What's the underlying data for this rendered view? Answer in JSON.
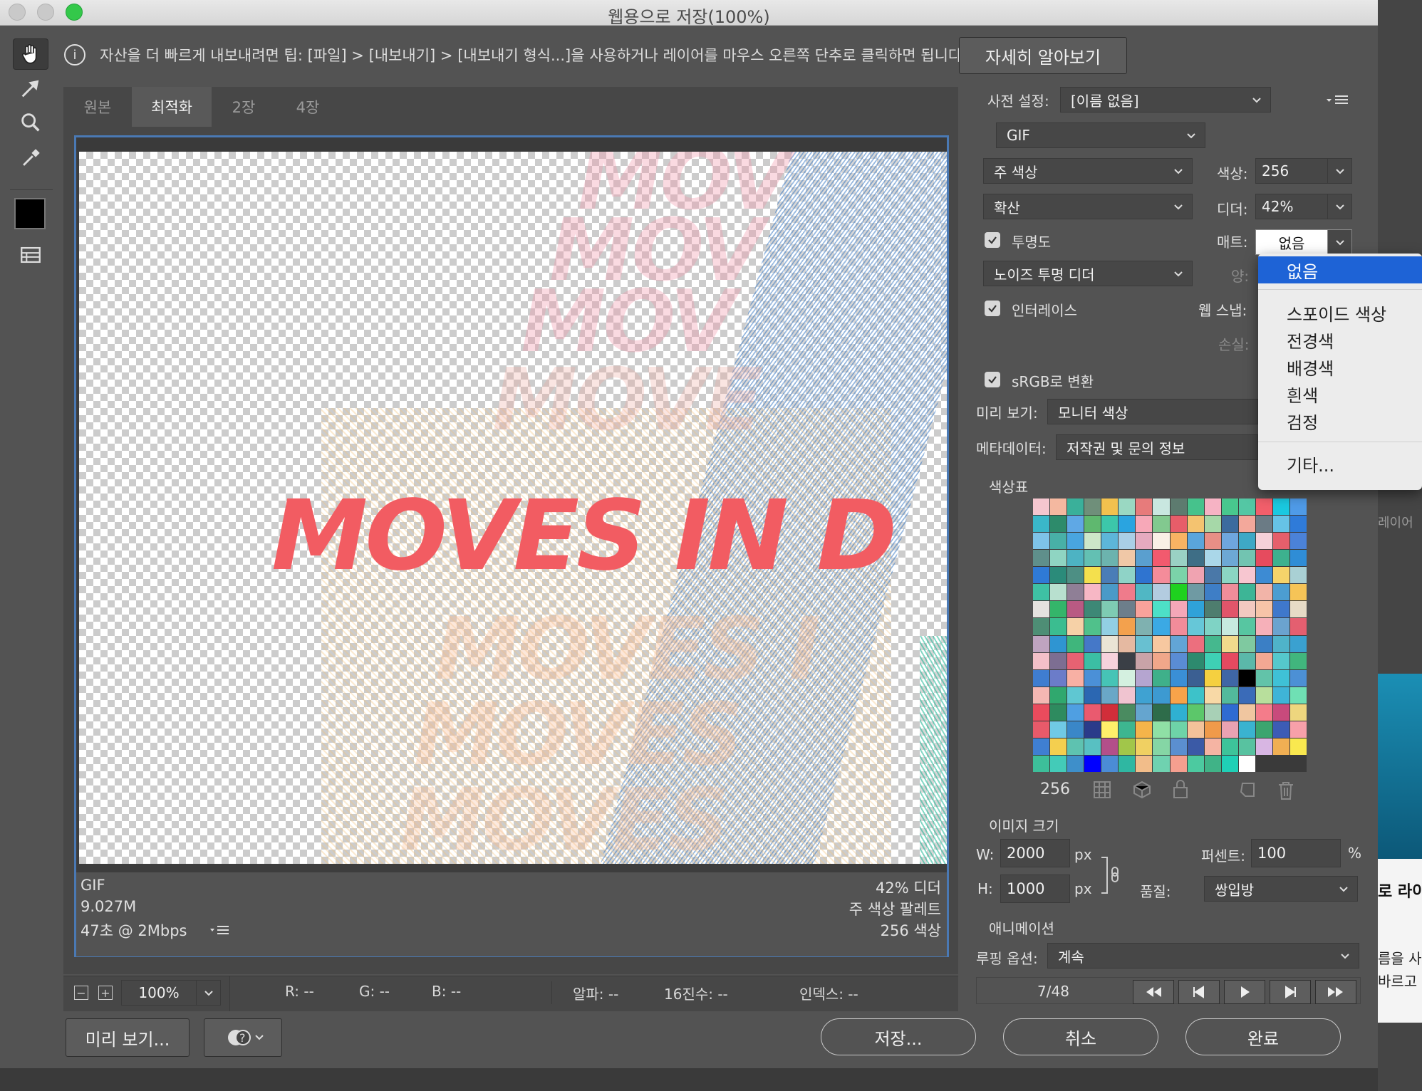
{
  "window": {
    "title": "웹용으로 저장(100%)"
  },
  "infobar": {
    "tip": "자산을 더 빠르게 내보내려면 팁: [파일] > [내보내기] > [내보내기 형식...]을 사용하거나 레이어를 마우스 오른쪽 단추로 클릭하면 됩니다.",
    "learn_more": "자세히 알아보기"
  },
  "tabs": [
    "원본",
    "최적화",
    "2장",
    "4장"
  ],
  "active_tab": "최적화",
  "preview": {
    "headline": "MOVES IN D",
    "ghost_text": [
      "MOV",
      "MOV",
      "MOV",
      "MOVE",
      "MOVES I",
      "MOVES",
      "MOVES"
    ],
    "info_left": [
      "GIF",
      "9.027M",
      "47초 @ 2Mbps"
    ],
    "info_right": [
      "42% 디더",
      "주 색상 팔레트",
      "256 색상"
    ]
  },
  "zoom": {
    "value": "100%"
  },
  "readout": {
    "r": "R: --",
    "g": "G: --",
    "b": "B: --",
    "alpha": "알파: --",
    "hex": "16진수: --",
    "index": "인덱스: --"
  },
  "settings": {
    "preset_label": "사전 설정:",
    "preset_value": "[이름 없음]",
    "format": "GIF",
    "reduction": "주 색상",
    "colors_label": "색상:",
    "colors_value": "256",
    "dither_algo": "확산",
    "dither_label": "디더:",
    "dither_value": "42%",
    "transparency_label": "투명도",
    "matte_label": "매트:",
    "matte_value": "없음",
    "transparency_dither": "노이즈 투명 디더",
    "amount_label": "양:",
    "interlace_label": "인터레이스",
    "websnap_label": "웹 스냅:",
    "lossy_label": "손실:",
    "srgb_label": "sRGB로 변환",
    "preview_label": "미리 보기:",
    "preview_value": "모니터 색상",
    "metadata_label": "메타데이터:",
    "metadata_value": "저작권 및 문의 정보",
    "color_table_label": "색상표",
    "color_count": "256",
    "image_size_label": "이미지 크기",
    "w_label": "W:",
    "w_value": "2000",
    "h_label": "H:",
    "h_value": "1000",
    "px": "px",
    "percent_label": "퍼센트:",
    "percent_value": "100",
    "percent_unit": "%",
    "quality_label": "품질:",
    "quality_value": "쌍입방",
    "animation_label": "애니메이션",
    "looping_label": "루핑 옵션:",
    "looping_value": "계속",
    "frame_counter": "7/48"
  },
  "matte_menu": {
    "items": [
      "없음",
      "스포이드 색상",
      "전경색",
      "배경색",
      "흰색",
      "검정",
      "기타..."
    ],
    "selected": "없음"
  },
  "buttons": {
    "preview": "미리 보기...",
    "save": "저장...",
    "cancel": "취소",
    "done": "완료"
  },
  "background_app": {
    "labels": [
      "레이어",
      "로 라이브",
      "름을 사",
      "바르고"
    ]
  },
  "palette_colors": [
    "#f5c6cf",
    "#f4b8a0",
    "#3ab09a",
    "#6f8f7a",
    "#f2c14e",
    "#9ad8c2",
    "#e77b7b",
    "#c9e7e0",
    "#5d7b6f",
    "#46c28c",
    "#f6b3c4",
    "#48c78e",
    "#54c7a4",
    "#f25f6b",
    "#1ac9e0",
    "#4f9be8",
    "#3ab7c9",
    "#2d8b6b",
    "#5fa8e5",
    "#5fb86f",
    "#3cc7aa",
    "#2aa4e0",
    "#f7a8b8",
    "#82c98f",
    "#e75d69",
    "#f4c370",
    "#a6d8a8",
    "#3c6b9e",
    "#f3a89b",
    "#6b7b85",
    "#66c3e6",
    "#2f7bd9",
    "#7ec3e8",
    "#48b0a7",
    "#49a5e0",
    "#cde7c9",
    "#5db6d9",
    "#aacfe6",
    "#e6aabf",
    "#f9f0e6",
    "#f8b363",
    "#5aa5db",
    "#e78f86",
    "#6fa6de",
    "#3ea8c6",
    "#f6d0d8",
    "#e55f6b",
    "#4b82d8",
    "#5f8f8b",
    "#8fd5c2",
    "#4db3c3",
    "#63c0b3",
    "#6cb3ae",
    "#f0c8a7",
    "#5a9fcf",
    "#f25a6e",
    "#9ad1c4",
    "#3e6e86",
    "#aad7e9",
    "#6da8d5",
    "#72c4b1",
    "#e64b5e",
    "#3db18e",
    "#2f8dd6",
    "#2f7ad6",
    "#2b8b7a",
    "#4d8f84",
    "#f4e04d",
    "#4a7db7",
    "#8fd3c7",
    "#2f74d0",
    "#f48c9a",
    "#7bd3a9",
    "#f0a3b1",
    "#4a78a8",
    "#8bd5c3",
    "#f7c6d0",
    "#3d8bd3",
    "#f5d36a",
    "#a9d0d4",
    "#3ec1a4",
    "#b8e0cf",
    "#8f7f96",
    "#f7b7c5",
    "#4a9ac8",
    "#ef7b8b",
    "#50b7c4",
    "#b3cce0",
    "#1fd11f",
    "#6f9aa3",
    "#3e7ec6",
    "#ef8d9a",
    "#3db596",
    "#f2b4a8",
    "#4c9dd1",
    "#f6c457",
    "#e5e2df",
    "#34b56a",
    "#b95a83",
    "#3d8876",
    "#7ecbb3",
    "#6d7e8b",
    "#f9a29b",
    "#4de0c7",
    "#f4a7b8",
    "#2fa2d9",
    "#4e7d6e",
    "#e1556a",
    "#f3c9c0",
    "#f7c4a8",
    "#3f78cb",
    "#e7dbc6",
    "#4e8e75",
    "#3bbd90",
    "#f6d1a7",
    "#50c18b",
    "#92cfe3",
    "#f3a14d",
    "#7fb1b0",
    "#3ba9e4",
    "#f28c9a",
    "#66c7d8",
    "#7fd3c5",
    "#c7eadf",
    "#57c6a1",
    "#f6b0b9",
    "#6ba3cf",
    "#e45f70",
    "#bfa4c0",
    "#2f95d2",
    "#3fb67c",
    "#4578c8",
    "#eae4d5",
    "#e5b9a1",
    "#68c0d1",
    "#f7c8a0",
    "#62a5d6",
    "#ec6f7e",
    "#45b88e",
    "#f2da8c",
    "#7fc9a0",
    "#3b7fc5",
    "#4fb3c9",
    "#3aa1d0",
    "#f3c0c9",
    "#7d6e92",
    "#e66272",
    "#3bbea4",
    "#f7d2dc",
    "#3a3f46",
    "#c9a3a8",
    "#f0a78a",
    "#5a8cd4",
    "#2d8a6e",
    "#3ed0b5",
    "#e54a60",
    "#5bb8a9",
    "#f3a893",
    "#55c8cc",
    "#41b67d",
    "#3f7dd0",
    "#6b7cc9",
    "#f8b0a4",
    "#4b90d7",
    "#46c4b6",
    "#d4f0e0",
    "#b5a5d0",
    "#3fb08a",
    "#3a8fd6",
    "#3b5f92",
    "#f5d040",
    "#3f66a6",
    "#000000",
    "#62c3a9",
    "#3fc1d6",
    "#4c90d5",
    "#f4b7b3",
    "#30a86e",
    "#5fc7d2",
    "#2b67b2",
    "#6aa7c7",
    "#f0c4d0",
    "#3fa2d2",
    "#3d9ad1",
    "#f7a34a",
    "#3dc2c9",
    "#f8d9a6",
    "#52ba9c",
    "#3a6bb8",
    "#b8df9c",
    "#3fb4d7",
    "#6fe0b4",
    "#ea4b5d",
    "#2e8b5f",
    "#4f9fe2",
    "#ea5a6f",
    "#d12e3a",
    "#4a8b60",
    "#65a5cf",
    "#2e6c4a",
    "#2fb0d2",
    "#5cc76a",
    "#a8d0b6",
    "#2f6bd2",
    "#f0c6a0",
    "#f47c8a",
    "#c84a7c",
    "#eed67e",
    "#e85a6a",
    "#70c9e5",
    "#3a87c8",
    "#2a3b8a",
    "#ffef6a",
    "#3db690",
    "#f5b44a",
    "#8fe0a5",
    "#6ed3a8",
    "#f3c29a",
    "#f09a4a",
    "#e9a2b2",
    "#3ab3d0",
    "#3ba56f",
    "#3c5cb5",
    "#f7a0a9",
    "#3f7fd2",
    "#f4cf4f",
    "#5ec2b0",
    "#58c0c2",
    "#b34f8a",
    "#a1c64a",
    "#f0d062",
    "#85d6a5",
    "#5b8fd0",
    "#3b5aa6",
    "#f5b4a3",
    "#3dc49a",
    "#58c2a0",
    "#d8b6e3",
    "#f0af53",
    "#f9e84f",
    "#3dbf9a",
    "#43cbb8",
    "#3e8fca",
    "#0000ff",
    "#4b8cd6",
    "#2fb7a2",
    "#f2bd8a",
    "#6fd2b0",
    "#f59f8f",
    "#4ccaa0",
    "#40b387",
    "#1fd0b6",
    "#ffffff"
  ]
}
